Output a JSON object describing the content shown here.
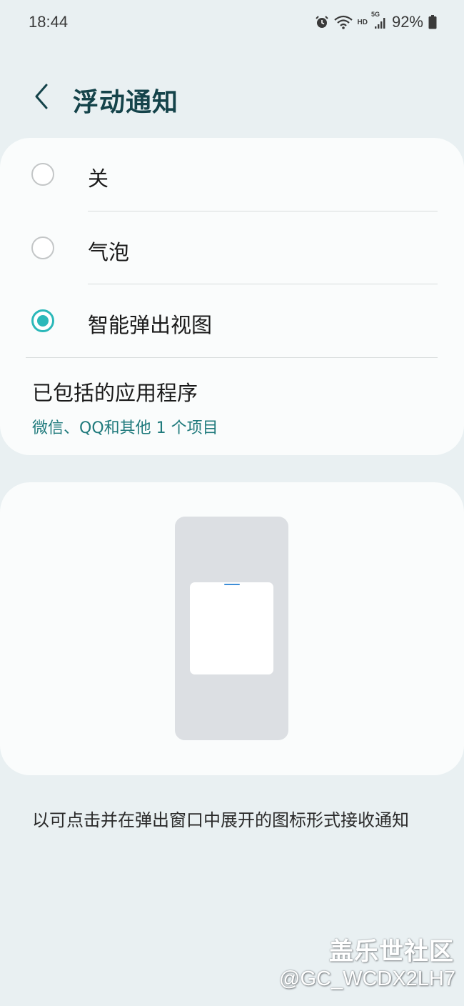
{
  "status_bar": {
    "time": "18:44",
    "network_hd": "HD",
    "network_5g": "5G",
    "battery": "92%",
    "icons": [
      "alarm-icon",
      "wifi-icon",
      "signal-icon",
      "battery-icon"
    ]
  },
  "header": {
    "title": "浮动通知",
    "back_icon": "chevron-left-icon"
  },
  "options": [
    {
      "label": "关",
      "selected": false
    },
    {
      "label": "气泡",
      "selected": false
    },
    {
      "label": "智能弹出视图",
      "selected": true
    }
  ],
  "included_apps": {
    "title": "已包括的应用程序",
    "subtitle": "微信、QQ和其他 1 个项目"
  },
  "description": "以可点击并在弹出窗口中展开的图标形式接收通知",
  "watermark": {
    "title": "盖乐世社区",
    "user": "@GC_WCDX2LH7"
  },
  "colors": {
    "background": "#e9f0f2",
    "card": "#fafcfc",
    "accent": "#2bb8b9",
    "title": "#14434a",
    "subtitle": "#1f7a7c"
  }
}
